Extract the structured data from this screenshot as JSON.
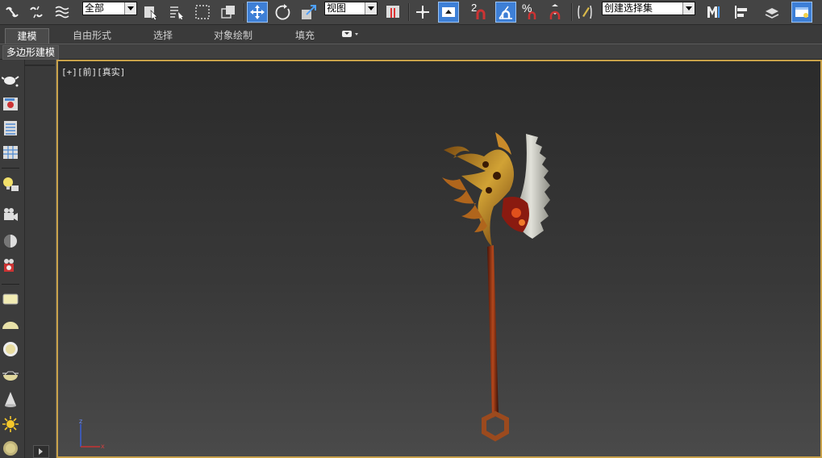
{
  "toolbar": {
    "selection_filter": "全部",
    "ref_coord_system": "视图",
    "named_selection_sets": "创建选择集",
    "snap_toggle_label": "2",
    "angle_snap_label": "%"
  },
  "ribbon": {
    "tabs": [
      {
        "label": "建模",
        "active": true
      },
      {
        "label": "自由形式",
        "active": false
      },
      {
        "label": "选择",
        "active": false
      },
      {
        "label": "对象绘制",
        "active": false
      },
      {
        "label": "填充",
        "active": false
      }
    ],
    "sub_label": "多边形建模"
  },
  "viewport": {
    "label": "[+][前][真实]",
    "axis_labels": {
      "z": "z",
      "x": "x"
    }
  },
  "colors": {
    "accent": "#3d7fd6",
    "viewport_border": "#c9a24a"
  }
}
